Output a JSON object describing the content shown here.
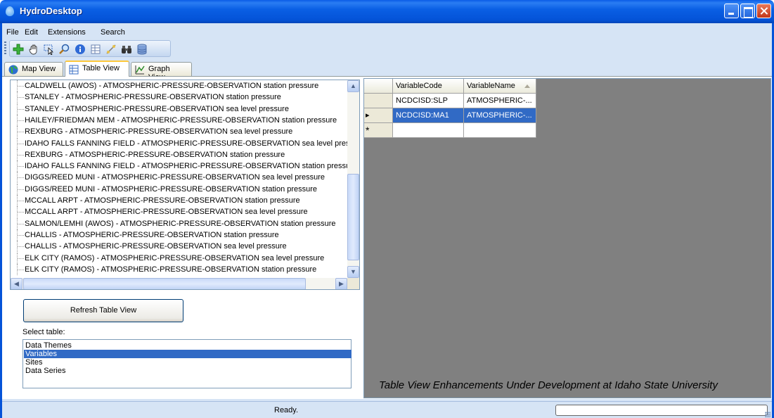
{
  "window": {
    "title": "HydroDesktop",
    "app_icon": "water-drop-icon"
  },
  "menu": [
    "File",
    "Edit",
    "Extensions",
    "Search"
  ],
  "toolbar": {
    "icons": [
      "add-layer-icon",
      "pan-hand-icon",
      "select-arrow-icon",
      "zoom-icon",
      "info-icon",
      "table-icon",
      "measure-icon",
      "binoculars-icon",
      "database-icon"
    ]
  },
  "tabs": [
    {
      "label": "Map View",
      "icon": "globe-icon",
      "active": false
    },
    {
      "label": "Table View",
      "icon": "table-icon",
      "active": true
    },
    {
      "label": "Graph View",
      "icon": "graph-icon",
      "active": false
    }
  ],
  "tree_items": [
    "CALDWELL (AWOS) - ATMOSPHERIC-PRESSURE-OBSERVATION station pressure",
    "STANLEY - ATMOSPHERIC-PRESSURE-OBSERVATION station pressure",
    "STANLEY - ATMOSPHERIC-PRESSURE-OBSERVATION sea level pressure",
    "HAILEY/FRIEDMAN MEM - ATMOSPHERIC-PRESSURE-OBSERVATION station pressure",
    "REXBURG - ATMOSPHERIC-PRESSURE-OBSERVATION sea level pressure",
    "IDAHO FALLS FANNING FIELD - ATMOSPHERIC-PRESSURE-OBSERVATION sea level pressure",
    "REXBURG - ATMOSPHERIC-PRESSURE-OBSERVATION station pressure",
    "IDAHO FALLS FANNING FIELD - ATMOSPHERIC-PRESSURE-OBSERVATION station pressure",
    "DIGGS/REED MUNI - ATMOSPHERIC-PRESSURE-OBSERVATION sea level pressure",
    "DIGGS/REED MUNI - ATMOSPHERIC-PRESSURE-OBSERVATION station pressure",
    "MCCALL ARPT - ATMOSPHERIC-PRESSURE-OBSERVATION station pressure",
    "MCCALL ARPT - ATMOSPHERIC-PRESSURE-OBSERVATION sea level pressure",
    "SALMON/LEMHI (AWOS) - ATMOSPHERIC-PRESSURE-OBSERVATION station pressure",
    "CHALLIS - ATMOSPHERIC-PRESSURE-OBSERVATION station pressure",
    "CHALLIS - ATMOSPHERIC-PRESSURE-OBSERVATION sea level pressure",
    "ELK CITY (RAMOS) - ATMOSPHERIC-PRESSURE-OBSERVATION sea level pressure",
    "ELK CITY (RAMOS) - ATMOSPHERIC-PRESSURE-OBSERVATION station pressure"
  ],
  "refresh_button": "Refresh Table View",
  "select_table_label": "Select table:",
  "select_table_options": [
    "Data Themes",
    "Variables",
    "Sites",
    "Data Series"
  ],
  "select_table_selected": "Variables",
  "grid": {
    "columns": [
      "VariableCode",
      "VariableName"
    ],
    "sorted_column": "VariableName",
    "rows": [
      [
        "NCDCISD:SLP",
        "ATMOSPHERIC-..."
      ],
      [
        "NCDCISD:MA1",
        "ATMOSPHERIC-..."
      ]
    ],
    "current_row_marker": "▸",
    "new_row_marker": "*",
    "selected_row": 1
  },
  "banner": "Table View Enhancements Under Development at Idaho State University",
  "status": {
    "text": "Ready.",
    "progress": 0
  }
}
